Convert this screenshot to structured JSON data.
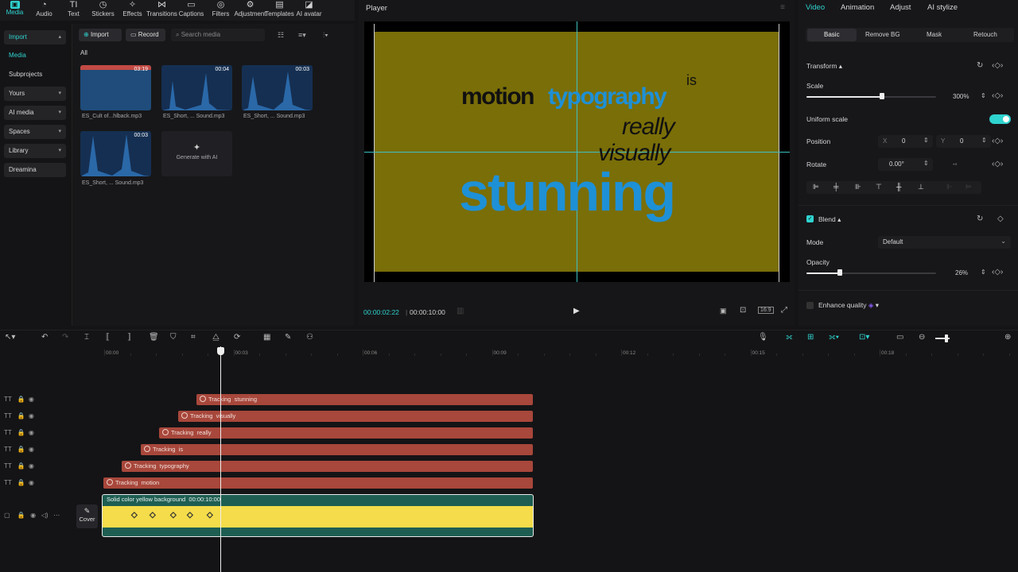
{
  "toolbar": {
    "items": [
      {
        "label": "Media",
        "icon": "media-icon",
        "glyph": "▣"
      },
      {
        "label": "Audio",
        "icon": "audio-icon",
        "glyph": "◔"
      },
      {
        "label": "Text",
        "icon": "text-icon",
        "glyph": "TI"
      },
      {
        "label": "Stickers",
        "icon": "stickers-icon",
        "glyph": "◷"
      },
      {
        "label": "Effects",
        "icon": "effects-icon",
        "glyph": "✧"
      },
      {
        "label": "Transitions",
        "icon": "transitions-icon",
        "glyph": "⋈"
      },
      {
        "label": "Captions",
        "icon": "captions-icon",
        "glyph": "▭"
      },
      {
        "label": "Filters",
        "icon": "filters-icon",
        "glyph": "◎"
      },
      {
        "label": "Adjustment",
        "icon": "adjustment-icon",
        "glyph": "⚙"
      },
      {
        "label": "Templates",
        "icon": "templates-icon",
        "glyph": "▤"
      },
      {
        "label": "AI avatar",
        "icon": "ai-avatar-icon",
        "glyph": "◪"
      }
    ]
  },
  "leftnav": {
    "import": "Import",
    "media": "Media",
    "subprojects": "Subprojects",
    "yours": "Yours",
    "ai_media": "AI media",
    "spaces": "Spaces",
    "library": "Library",
    "dreamina": "Dreamina"
  },
  "media": {
    "import_btn": "Import",
    "record_btn": "Record",
    "search_placeholder": "Search media",
    "filter_all": "All",
    "items": [
      {
        "name": "ES_Cult of...hlback.mp3",
        "duration": "03:19"
      },
      {
        "name": "ES_Short, ... Sound.mp3",
        "duration": "00:04"
      },
      {
        "name": "ES_Short, ... Sound.mp3",
        "duration": "00:03"
      },
      {
        "name": "ES_Short, ... Sound.mp3",
        "duration": "00:03"
      }
    ],
    "generate_ai": "Generate with AI"
  },
  "player": {
    "title": "Player",
    "current_time": "00:00:02:22",
    "total_time": "00:00:10:00",
    "ratio": "16:9",
    "words": {
      "motion": "motion",
      "typography": "typography",
      "is": "is",
      "really": "really",
      "visually": "visually",
      "stunning": "stunning"
    },
    "colors": {
      "black_text": "#111111",
      "blue_text": "#1e90d6",
      "bg": "#7a6e08"
    }
  },
  "right": {
    "tabs": [
      "Video",
      "Animation",
      "Adjust",
      "AI stylize"
    ],
    "subtabs": [
      "Basic",
      "Remove BG",
      "Mask",
      "Retouch"
    ],
    "transform": "Transform",
    "scale_label": "Scale",
    "scale_value": "300%",
    "scale_fraction": 0.58,
    "uniform_scale": "Uniform scale",
    "position_label": "Position",
    "pos_x_label": "X",
    "pos_x": "0",
    "pos_y_label": "Y",
    "pos_y": "0",
    "rotate_label": "Rotate",
    "rotate_value": "0.00°",
    "blend": "Blend",
    "mode_label": "Mode",
    "mode_value": "Default",
    "opacity_label": "Opacity",
    "opacity_value": "26%",
    "opacity_fraction": 0.26,
    "enhance": "Enhance quality",
    "accent": "#2fd3cf"
  },
  "timeline": {
    "ticks": [
      "00:00",
      "00:03",
      "00:06",
      "00:09",
      "00:12",
      "00:15",
      "00:18"
    ],
    "text_tracks": [
      {
        "word": "stunning"
      },
      {
        "word": "visually"
      },
      {
        "word": "really"
      },
      {
        "word": "is"
      },
      {
        "word": "typography"
      },
      {
        "word": "motion"
      }
    ],
    "tracking_label": "Tracking",
    "bg_clip_name": "Solid color yellow background",
    "bg_clip_duration": "00:00:10:00",
    "cover_label": "Cover"
  }
}
